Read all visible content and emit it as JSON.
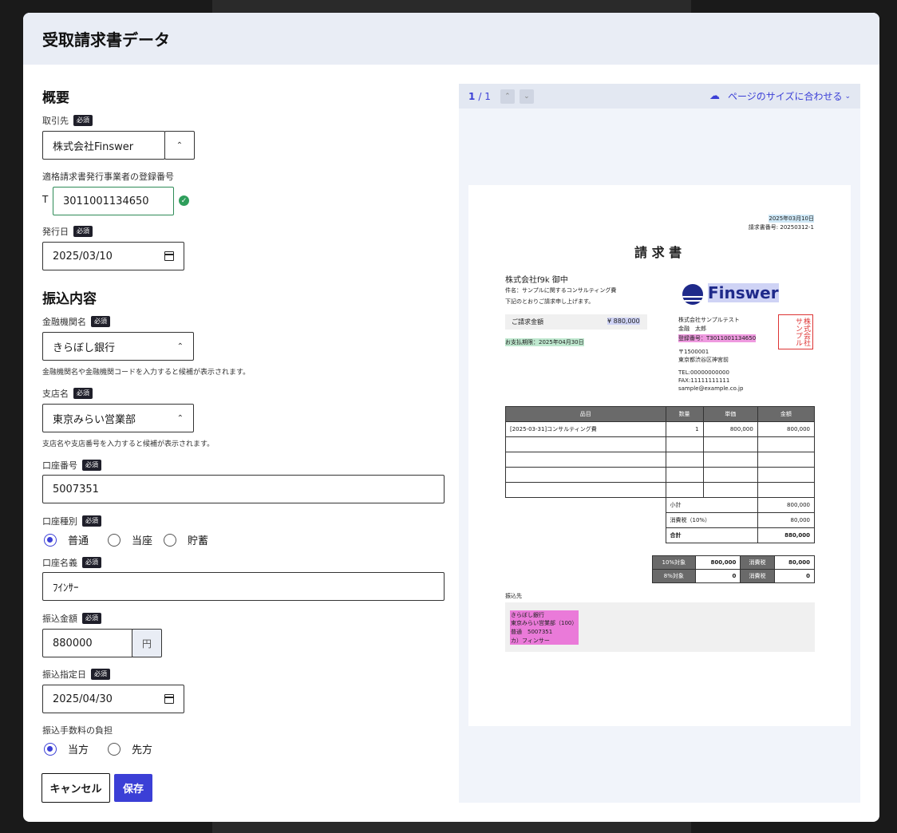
{
  "modal": {
    "title": "受取請求書データ"
  },
  "form": {
    "overview_title": "概要",
    "required": "必須",
    "partner": {
      "label": "取引先",
      "value": "株式会社Finswer"
    },
    "registration": {
      "label": "適格請求書発行事業者の登録番号",
      "prefix": "T",
      "value": "3011001134650",
      "valid": true
    },
    "issue_date": {
      "label": "発行日",
      "value": "2025/03/10"
    },
    "transfer_title": "振込内容",
    "bank": {
      "label": "金融機関名",
      "value": "きらぼし銀行",
      "hint": "金融機関名や金融機関コードを入力すると候補が表示されます。"
    },
    "branch": {
      "label": "支店名",
      "value": "東京みらい営業部",
      "hint": "支店名や支店番号を入力すると候補が表示されます。"
    },
    "account_number": {
      "label": "口座番号",
      "value": "5007351"
    },
    "account_type": {
      "label": "口座種別",
      "options": [
        "普通",
        "当座",
        "貯蓄"
      ],
      "selected": "普通"
    },
    "account_name": {
      "label": "口座名義",
      "value": "ﾌｲﾝｻｰ"
    },
    "amount": {
      "label": "振込金額",
      "value": "880000",
      "unit": "円"
    },
    "transfer_date": {
      "label": "振込指定日",
      "value": "2025/04/30"
    },
    "fee": {
      "label": "振込手数料の負担",
      "options": [
        "当方",
        "先方"
      ],
      "selected": "当方"
    },
    "cancel_label": "キャンセル",
    "save_label": "保存"
  },
  "preview": {
    "page_current": "1",
    "page_total": "/ 1",
    "fit_label": "ページのサイズに合わせる",
    "invoice": {
      "date": "2025年03月10日",
      "invoice_number": "請求書番号: 20250312-1",
      "title": "請 求 書",
      "addressee": "株式会社f9k 御中",
      "subject": "件名：サンプルに関するコンサルティング費",
      "lead": "下記のとおりご請求申し上げます。",
      "amount_label": "ご請求金額",
      "amount_value": "¥ 880,000",
      "due": "お支払期限：2025年04月30日",
      "logo": "Finswer",
      "company": "株式会社サンプルテスト",
      "person": "金融　太郎",
      "registration": "登録番号：T3011001134650",
      "postal": "〒1500001",
      "address": "東京都渋谷区神宮前",
      "tel": "TEL:00000000000",
      "fax": "FAX:11111111111",
      "email": "sample@example.co.jp",
      "seal": "株式会社サンプル",
      "headers": [
        "品目",
        "数量",
        "単価",
        "金額"
      ],
      "item": {
        "name": "[2025-03-31]コンサルティング費",
        "qty": "1",
        "price": "800,000",
        "amount": "800,000"
      },
      "subtotal_label": "小計",
      "subtotal": "800,000",
      "tax_label": "消費税（10%）",
      "tax": "80,000",
      "total_label": "合計",
      "total": "880,000",
      "tax10_label": "10%対象",
      "tax10_base": "800,000",
      "tax10_tax_label": "消費税",
      "tax10_tax": "80,000",
      "tax8_label": "8%対象",
      "tax8_base": "0",
      "tax8_tax_label": "消費税",
      "tax8_tax": "0",
      "payee_title": "振込先",
      "payee_lines": [
        "きらぼし銀行",
        "東京みらい営業部（100）",
        "普通　5007351",
        "カ）フィンサー"
      ]
    }
  }
}
